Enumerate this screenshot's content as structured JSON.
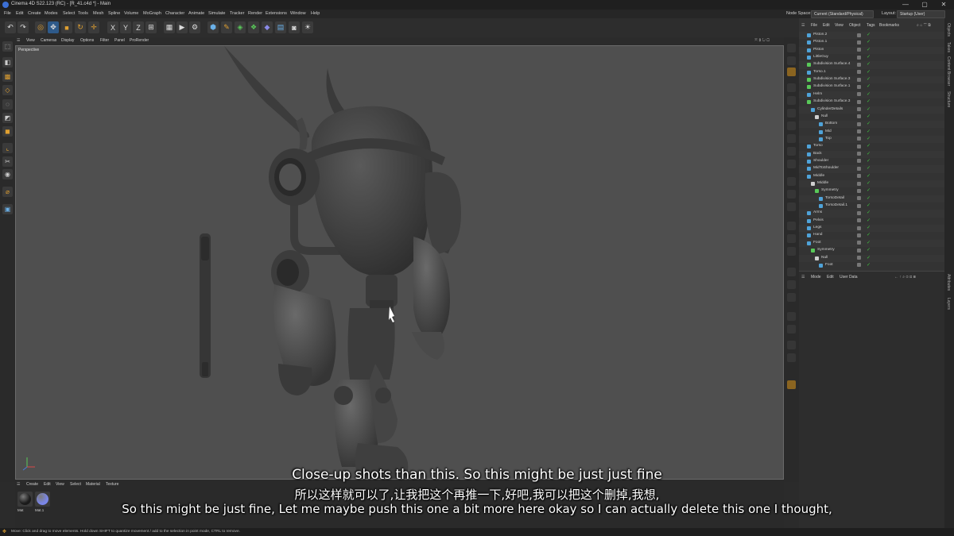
{
  "window": {
    "title": "Cinema 4D S22.123 (RC) - [R_41.c4d *] - Main",
    "controls": [
      "—",
      "▢",
      "✕"
    ]
  },
  "menu": [
    "File",
    "Edit",
    "Create",
    "Modes",
    "Select",
    "Tools",
    "Mesh",
    "Spline",
    "Volume",
    "MoGraph",
    "Character",
    "Animate",
    "Simulate",
    "Tracker",
    "Render",
    "Extensions",
    "Window",
    "Help"
  ],
  "node_space": {
    "label": "Node Space:",
    "value": "Current (Standard/Physical)"
  },
  "layout": {
    "label": "Layout:",
    "value": "Startup (User)"
  },
  "viewport": {
    "menu": [
      "View",
      "Cameras",
      "Display",
      "Options",
      "Filter",
      "Panel",
      "ProRender"
    ],
    "label": "Perspective"
  },
  "materials": {
    "menu": [
      "Create",
      "Edit",
      "View",
      "Select",
      "Material",
      "Texture"
    ],
    "items": [
      {
        "label": "Mat",
        "color": "#1a1a1a"
      },
      {
        "label": "Mat.1",
        "color": "#7a86e8"
      }
    ]
  },
  "status": "Move: Click and drag to move elements. Hold down SHIFT to quantize movement / add to the selection in point mode, CTRL to remove.",
  "object_manager": {
    "menu": [
      "File",
      "Edit",
      "View",
      "Object",
      "Tags",
      "Bookmarks"
    ],
    "objects": [
      {
        "name": "Piston.2",
        "level": 0,
        "color": "#4fa3d9"
      },
      {
        "name": "Piston.1",
        "level": 0,
        "color": "#4fa3d9"
      },
      {
        "name": "Piston",
        "level": 0,
        "color": "#4fa3d9"
      },
      {
        "name": "LittleGuy",
        "level": 0,
        "color": "#4fa3d9"
      },
      {
        "name": "Subdivision Surface.4",
        "level": 0,
        "color": "#59c959"
      },
      {
        "name": "Torso.1",
        "level": 0,
        "color": "#4fa3d9"
      },
      {
        "name": "Subdivision Surface.3",
        "level": 0,
        "color": "#59c959"
      },
      {
        "name": "Subdivision Surface.1",
        "level": 0,
        "color": "#59c959"
      },
      {
        "name": "Helm",
        "level": 0,
        "color": "#4fa3d9"
      },
      {
        "name": "Subdivision Surface.3",
        "level": 0,
        "color": "#59c959"
      },
      {
        "name": "CylinderDetails",
        "level": 1,
        "color": "#4fa3d9"
      },
      {
        "name": "Null",
        "level": 2,
        "color": "#cfcfcf"
      },
      {
        "name": "Bottom",
        "level": 3,
        "color": "#4fa3d9"
      },
      {
        "name": "Mid",
        "level": 3,
        "color": "#4fa3d9"
      },
      {
        "name": "Top",
        "level": 3,
        "color": "#4fa3d9"
      },
      {
        "name": "Torso",
        "level": 0,
        "color": "#4fa3d9"
      },
      {
        "name": "Back",
        "level": 0,
        "color": "#4fa3d9"
      },
      {
        "name": "Shoulder",
        "level": 0,
        "color": "#4fa3d9"
      },
      {
        "name": "MidToShoulder",
        "level": 0,
        "color": "#4fa3d9"
      },
      {
        "name": "Middle",
        "level": 0,
        "color": "#4fa3d9"
      },
      {
        "name": "Middle",
        "level": 1,
        "color": "#cfcfcf"
      },
      {
        "name": "Symmetry",
        "level": 2,
        "color": "#59c959"
      },
      {
        "name": "TorsoDetail",
        "level": 3,
        "color": "#4fa3d9"
      },
      {
        "name": "TorsoDetail.1",
        "level": 3,
        "color": "#4fa3d9"
      },
      {
        "name": "Arms",
        "level": 0,
        "color": "#4fa3d9"
      },
      {
        "name": "Pelvis",
        "level": 0,
        "color": "#4fa3d9"
      },
      {
        "name": "Legs",
        "level": 0,
        "color": "#4fa3d9"
      },
      {
        "name": "Hand",
        "level": 0,
        "color": "#4fa3d9"
      },
      {
        "name": "Foot",
        "level": 0,
        "color": "#4fa3d9"
      },
      {
        "name": "Symmetry",
        "level": 1,
        "color": "#59c959"
      },
      {
        "name": "Null",
        "level": 2,
        "color": "#cfcfcf"
      },
      {
        "name": "Foot",
        "level": 3,
        "color": "#4fa3d9"
      }
    ]
  },
  "attributes": {
    "menu": [
      "Mode",
      "Edit",
      "User Data"
    ]
  },
  "side_tabs": [
    "Objects",
    "Takes",
    "Content Browser",
    "Structure",
    "Attributes",
    "Layers"
  ],
  "subtitles": {
    "line1": "Close-up shots than this. So this might be just just fine",
    "line2": "所以这样就可以了,让我把这个再推一下,好吧,我可以把这个删掉,我想,",
    "line3": "So this might be just fine, Let me maybe push this one a bit more here okay so I can actually delete this one I thought,"
  }
}
